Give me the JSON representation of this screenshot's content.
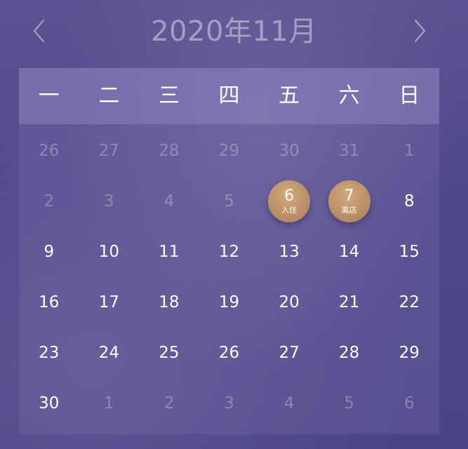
{
  "header": {
    "title": "2020年11月",
    "prev_icon": "chevron-left-icon",
    "next_icon": "chevron-right-icon"
  },
  "weekdays": [
    "一",
    "二",
    "三",
    "四",
    "五",
    "六",
    "日"
  ],
  "colors": {
    "accent": "#bd9168",
    "muted_text": "rgba(255,255,255,0.28)"
  },
  "weeks": [
    [
      {
        "day": "26",
        "muted": true
      },
      {
        "day": "27",
        "muted": true
      },
      {
        "day": "28",
        "muted": true
      },
      {
        "day": "29",
        "muted": true
      },
      {
        "day": "30",
        "muted": true
      },
      {
        "day": "31",
        "muted": true
      },
      {
        "day": "1",
        "muted": true
      }
    ],
    [
      {
        "day": "2",
        "muted": true
      },
      {
        "day": "3",
        "muted": true
      },
      {
        "day": "4",
        "muted": true
      },
      {
        "day": "5",
        "muted": true
      },
      {
        "day": "6",
        "selected": true,
        "label": "入住"
      },
      {
        "day": "7",
        "selected": true,
        "label": "离店"
      },
      {
        "day": "8"
      }
    ],
    [
      {
        "day": "9"
      },
      {
        "day": "10"
      },
      {
        "day": "11"
      },
      {
        "day": "12"
      },
      {
        "day": "13"
      },
      {
        "day": "14"
      },
      {
        "day": "15"
      }
    ],
    [
      {
        "day": "16"
      },
      {
        "day": "17"
      },
      {
        "day": "18"
      },
      {
        "day": "19"
      },
      {
        "day": "20"
      },
      {
        "day": "21"
      },
      {
        "day": "22"
      }
    ],
    [
      {
        "day": "23"
      },
      {
        "day": "24"
      },
      {
        "day": "25"
      },
      {
        "day": "26"
      },
      {
        "day": "27"
      },
      {
        "day": "28"
      },
      {
        "day": "29"
      }
    ],
    [
      {
        "day": "30"
      },
      {
        "day": "1",
        "muted": true
      },
      {
        "day": "2",
        "muted": true
      },
      {
        "day": "3",
        "muted": true
      },
      {
        "day": "4",
        "muted": true
      },
      {
        "day": "5",
        "muted": true
      },
      {
        "day": "6",
        "muted": true
      }
    ]
  ]
}
